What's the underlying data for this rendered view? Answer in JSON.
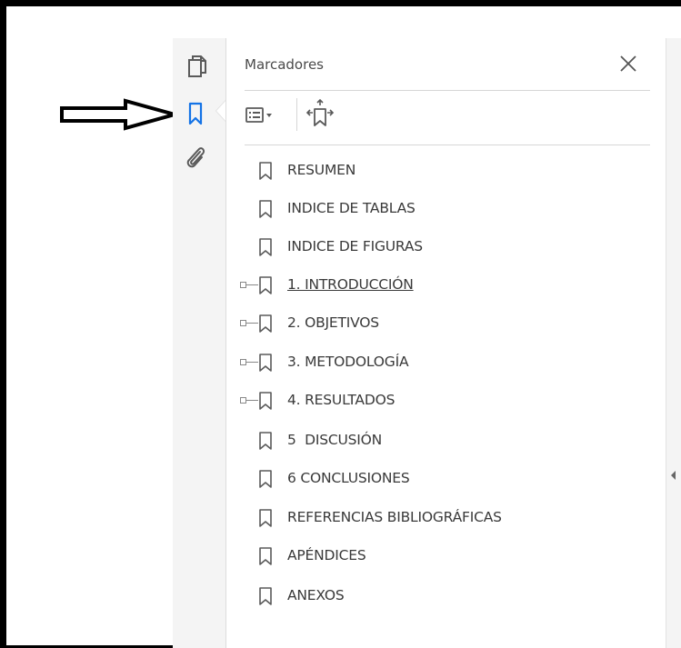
{
  "panel": {
    "title": "Marcadores"
  },
  "rail": {
    "items": [
      {
        "icon": "pages-icon"
      },
      {
        "icon": "bookmark-icon",
        "active": true
      },
      {
        "icon": "attachment-icon"
      }
    ]
  },
  "toolbar": {
    "options_icon": "options-menu-icon",
    "expand_icon": "expand-bookmark-icon"
  },
  "bookmarks": [
    {
      "label": "RESUMEN",
      "expandable": false
    },
    {
      "label": "INDICE DE TABLAS",
      "expandable": false
    },
    {
      "label": "INDICE DE FIGURAS",
      "expandable": false
    },
    {
      "label": "1. INTRODUCCIÓN",
      "expandable": true,
      "underlined": true
    },
    {
      "label": "2. OBJETIVOS",
      "expandable": true
    },
    {
      "label": "3. METODOLOGÍA",
      "expandable": true
    },
    {
      "label": "4. RESULTADOS",
      "expandable": true
    },
    {
      "label": "5  DISCUSIÓN",
      "expandable": false
    },
    {
      "label": "6 CONCLUSIONES",
      "expandable": false
    },
    {
      "label": "REFERENCIAS BIBLIOGRÁFICAS",
      "expandable": false
    },
    {
      "label": "APÉNDICES",
      "expandable": false
    },
    {
      "label": "ANEXOS",
      "expandable": false
    }
  ],
  "colors": {
    "accent": "#1473e6",
    "icon": "#5a5a5a"
  }
}
